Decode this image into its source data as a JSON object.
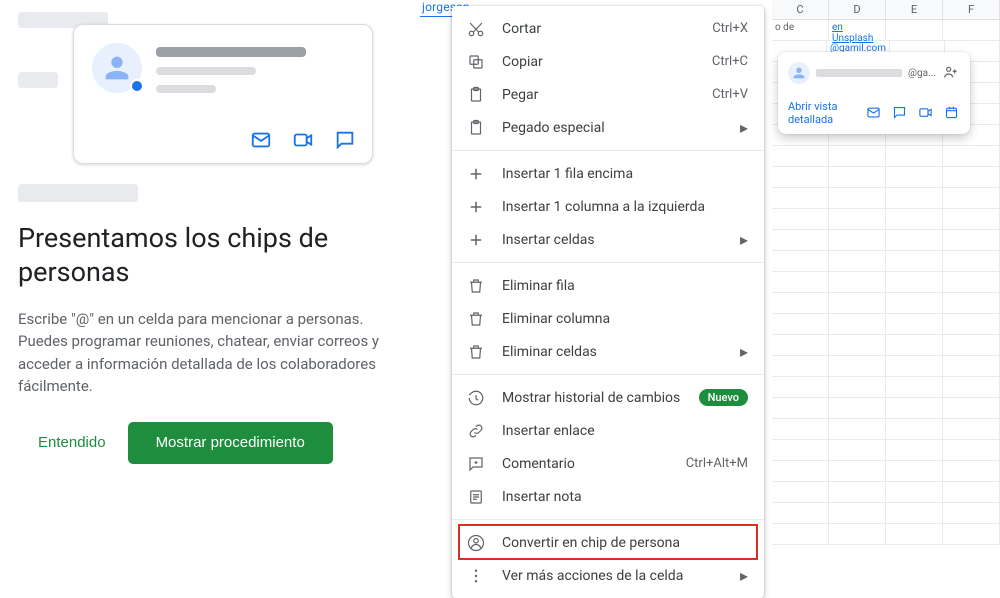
{
  "promo": {
    "title": "Presentamos los chips de personas",
    "body": "Escribe \"@\" en un celda para mencionar a personas. Puedes programar reuniones, chatear, enviar correos y acceder a información detallada de los colaboradores fácilmente.",
    "btn_dismiss": "Entendido",
    "btn_cta": "Mostrar procedimiento"
  },
  "cell": {
    "email_partial": "jorgesan"
  },
  "menu": {
    "cut": {
      "label": "Cortar",
      "shortcut": "Ctrl+X"
    },
    "copy": {
      "label": "Copiar",
      "shortcut": "Ctrl+C"
    },
    "paste": {
      "label": "Pegar",
      "shortcut": "Ctrl+V"
    },
    "paste_sp": {
      "label": "Pegado especial"
    },
    "ins_row": {
      "label": "Insertar 1 fila encima"
    },
    "ins_col": {
      "label": "Insertar 1 columna a la izquierda"
    },
    "ins_cells": {
      "label": "Insertar celdas"
    },
    "del_row": {
      "label": "Eliminar fila"
    },
    "del_col": {
      "label": "Eliminar columna"
    },
    "del_cells": {
      "label": "Eliminar celdas"
    },
    "history": {
      "label": "Mostrar historial de cambios",
      "badge": "Nuevo"
    },
    "link": {
      "label": "Insertar enlace"
    },
    "comment": {
      "label": "Comentario",
      "shortcut": "Ctrl+Alt+M"
    },
    "note": {
      "label": "Insertar nota"
    },
    "chip": {
      "label": "Convertir en chip de persona"
    },
    "more": {
      "label": "Ver más acciones de la celda"
    }
  },
  "sheet": {
    "cols": [
      "C",
      "D",
      "E",
      "F"
    ],
    "row1_a": "o de",
    "row1_b": "en Unsplash",
    "row2_b": "@gamil.com"
  },
  "person_card": {
    "email_suffix": "@ga...",
    "open": "Abrir vista detallada"
  }
}
